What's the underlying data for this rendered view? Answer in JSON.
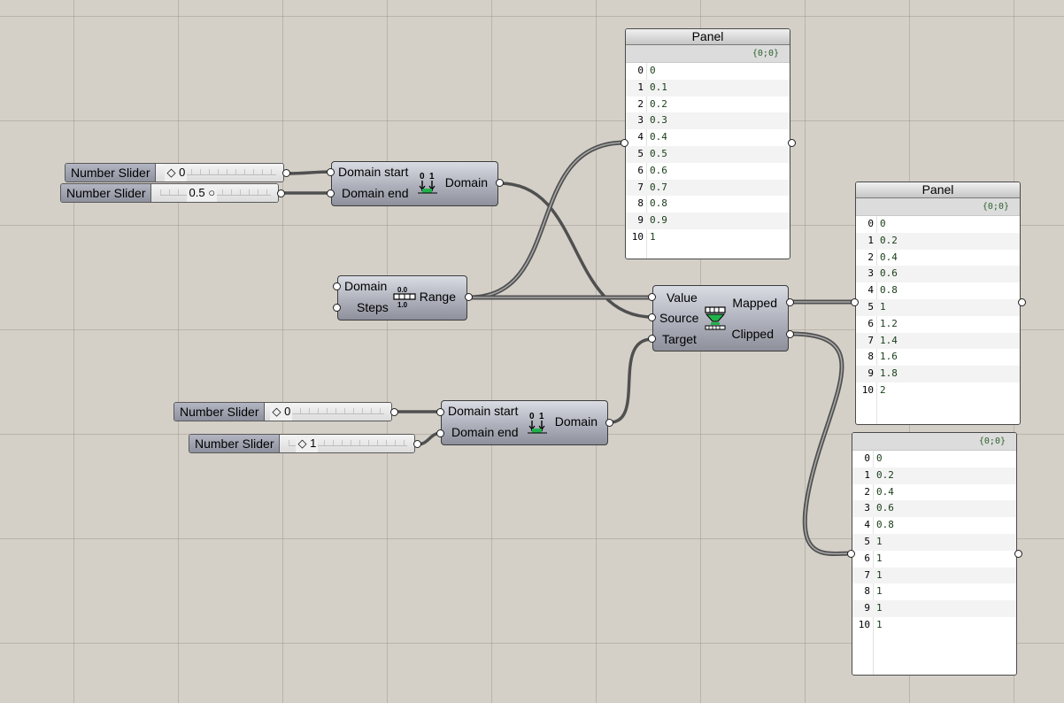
{
  "sliders": [
    {
      "label": "Number Slider",
      "value": "0"
    },
    {
      "label": "Number Slider",
      "value": "0.5"
    },
    {
      "label": "Number Slider",
      "value": "0"
    },
    {
      "label": "Number Slider",
      "value": "1"
    }
  ],
  "construct_domain_1": {
    "input_start": "Domain start",
    "input_end": "Domain end",
    "output": "Domain"
  },
  "construct_domain_2": {
    "input_start": "Domain start",
    "input_end": "Domain end",
    "output": "Domain"
  },
  "range": {
    "input_domain": "Domain",
    "input_steps": "Steps",
    "output": "Range",
    "icon_top": "0.0",
    "icon_bottom": "1.0"
  },
  "remap": {
    "input_value": "Value",
    "input_source": "Source",
    "input_target": "Target",
    "output_mapped": "Mapped",
    "output_clipped": "Clipped"
  },
  "domain_icon": {
    "digits": "0 1"
  },
  "panel_range": {
    "title": "Panel",
    "path": "{0;0}",
    "items": [
      {
        "index": "0",
        "value": "0"
      },
      {
        "index": "1",
        "value": "0.1"
      },
      {
        "index": "2",
        "value": "0.2"
      },
      {
        "index": "3",
        "value": "0.3"
      },
      {
        "index": "4",
        "value": "0.4"
      },
      {
        "index": "5",
        "value": "0.5"
      },
      {
        "index": "6",
        "value": "0.6"
      },
      {
        "index": "7",
        "value": "0.7"
      },
      {
        "index": "8",
        "value": "0.8"
      },
      {
        "index": "9",
        "value": "0.9"
      },
      {
        "index": "10",
        "value": "1"
      }
    ]
  },
  "panel_mapped": {
    "title": "Panel",
    "path": "{0;0}",
    "items": [
      {
        "index": "0",
        "value": "0"
      },
      {
        "index": "1",
        "value": "0.2"
      },
      {
        "index": "2",
        "value": "0.4"
      },
      {
        "index": "3",
        "value": "0.6"
      },
      {
        "index": "4",
        "value": "0.8"
      },
      {
        "index": "5",
        "value": "1"
      },
      {
        "index": "6",
        "value": "1.2"
      },
      {
        "index": "7",
        "value": "1.4"
      },
      {
        "index": "8",
        "value": "1.6"
      },
      {
        "index": "9",
        "value": "1.8"
      },
      {
        "index": "10",
        "value": "2"
      }
    ]
  },
  "panel_clipped": {
    "path": "{0;0}",
    "items": [
      {
        "index": "0",
        "value": "0"
      },
      {
        "index": "1",
        "value": "0.2"
      },
      {
        "index": "2",
        "value": "0.4"
      },
      {
        "index": "3",
        "value": "0.6"
      },
      {
        "index": "4",
        "value": "0.8"
      },
      {
        "index": "5",
        "value": "1"
      },
      {
        "index": "6",
        "value": "1"
      },
      {
        "index": "7",
        "value": "1"
      },
      {
        "index": "8",
        "value": "1"
      },
      {
        "index": "9",
        "value": "1"
      },
      {
        "index": "10",
        "value": "1"
      }
    ]
  },
  "colors": {
    "wire": "#505050",
    "wire_inner": "#a8a8a8",
    "canvas": "#d4d0c8",
    "icon_green": "#22b14c"
  }
}
